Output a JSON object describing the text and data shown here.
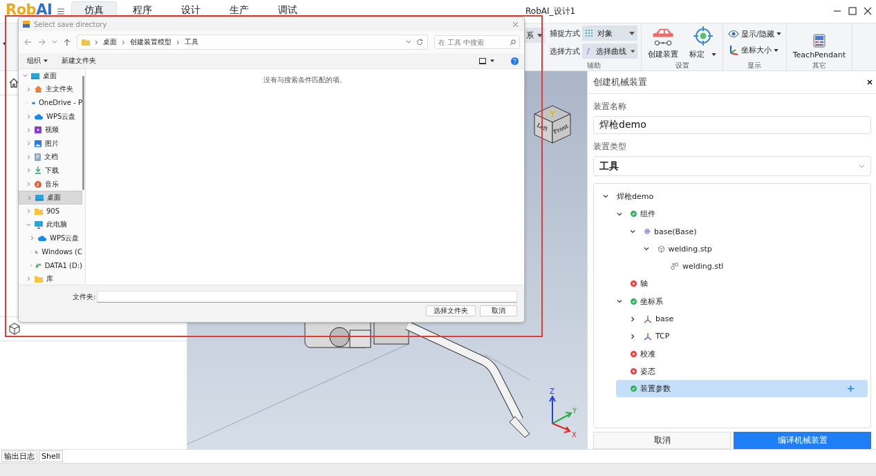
{
  "app": {
    "logo": [
      {
        "text": "Rob",
        "color": "#f0a81c"
      },
      {
        "text": "AI",
        "color": "#2f6fd6"
      }
    ],
    "title": "RobAI_设计1"
  },
  "menu_tabs": [
    {
      "label": "仿真",
      "selected": true
    },
    {
      "label": "程序",
      "selected": false
    },
    {
      "label": "设计",
      "selected": false
    },
    {
      "label": "生产",
      "selected": false
    },
    {
      "label": "调试",
      "selected": false
    }
  ],
  "ribbon": {
    "partial_dropdown": {
      "value": "系"
    },
    "groups": [
      {
        "label": "辅助",
        "items": [
          {
            "kind": "field",
            "label": "捕捉方式",
            "value": "对象"
          },
          {
            "kind": "field",
            "label": "选择方式",
            "value": "选择曲线"
          }
        ]
      },
      {
        "label": "设置",
        "items": [
          {
            "kind": "large",
            "label": "创建装置",
            "has_menu": false
          },
          {
            "kind": "large",
            "label": "标定",
            "has_menu": true
          }
        ]
      },
      {
        "label": "显示",
        "items": [
          {
            "kind": "small",
            "label": "显示/隐藏",
            "has_menu": true
          },
          {
            "kind": "small",
            "label": "坐标大小",
            "has_menu": true
          }
        ]
      },
      {
        "label": "其它",
        "items": [
          {
            "kind": "large",
            "label": "TeachPendant",
            "has_menu": false
          }
        ]
      }
    ]
  },
  "viewport": {
    "view_cube": [
      {
        "label": "Left"
      },
      {
        "label": "Front"
      }
    ],
    "axes": [
      {
        "label": "Z",
        "color": "#1f3fe0"
      },
      {
        "label": "Y",
        "color": "#22b03a"
      },
      {
        "label": "X",
        "color": "#e02424"
      }
    ]
  },
  "right_panel": {
    "title": "创建机械装置",
    "name_label": "装置名称",
    "name_value": "焊枪demo",
    "type_label": "装置类型",
    "type_value": "工具",
    "tree": [
      {
        "label": "焊枪demo",
        "expanded": true,
        "selected": false,
        "children": [
          {
            "label": "组件",
            "kind": "ok",
            "expanded": true,
            "selected": false,
            "children": [
              {
                "label": "base(Base)",
                "kind": "gear",
                "expanded": true,
                "selected": false,
                "children": [
                  {
                    "label": "welding.stp",
                    "kind": "cube",
                    "expanded": true,
                    "selected": false,
                    "children": [
                      {
                        "label": "welding.stl",
                        "kind": "mesh",
                        "selected": false
                      }
                    ]
                  }
                ]
              }
            ]
          },
          {
            "label": "轴",
            "kind": "error",
            "selected": false
          },
          {
            "label": "坐标系",
            "kind": "ok",
            "expanded": true,
            "selected": false,
            "children": [
              {
                "label": "base",
                "kind": "frame",
                "expanded": false,
                "selected": false
              },
              {
                "label": "TCP",
                "kind": "frame",
                "expanded": false,
                "selected": false
              }
            ]
          },
          {
            "label": "校准",
            "kind": "error",
            "selected": false
          },
          {
            "label": "姿态",
            "kind": "error",
            "selected": false
          },
          {
            "label": "装置参数",
            "kind": "ok",
            "selected": true
          }
        ]
      }
    ],
    "buttons": [
      {
        "label": "取消",
        "kind": "secondary"
      },
      {
        "label": "编译机械装置",
        "kind": "primary"
      }
    ]
  },
  "bottom_tabs": [
    {
      "label": "输出日志",
      "selected": false
    },
    {
      "label": "Shell",
      "selected": false
    }
  ],
  "dialog": {
    "title": "Select save directory",
    "breadcrumb": [
      "桌面",
      "创建装置模型",
      "工具"
    ],
    "search_placeholder": "在 工具 中搜索",
    "toolbar": [
      {
        "label": "组织",
        "has_menu": true
      },
      {
        "label": "新建文件夹",
        "has_menu": false
      }
    ],
    "nav_tree": [
      {
        "label": "桌面",
        "kind": "desktop",
        "expanded": true,
        "selected": false,
        "children": [
          {
            "label": "主文件夹",
            "kind": "home",
            "expanded": false,
            "selected": false
          },
          {
            "label": "OneDrive - P",
            "kind": "cloud",
            "expanded": false,
            "selected": false
          },
          {
            "label": "WPS云盘",
            "kind": "cloud",
            "expanded": false,
            "selected": false
          },
          {
            "label": "视频",
            "kind": "video",
            "expanded": false,
            "selected": false
          },
          {
            "label": "图片",
            "kind": "picture",
            "expanded": false,
            "selected": false
          },
          {
            "label": "文档",
            "kind": "document",
            "expanded": false,
            "selected": false
          },
          {
            "label": "下载",
            "kind": "download",
            "expanded": false,
            "selected": false
          },
          {
            "label": "音乐",
            "kind": "music",
            "expanded": false,
            "selected": false
          },
          {
            "label": "桌面",
            "kind": "desktop",
            "expanded": false,
            "selected": true
          },
          {
            "label": "90S",
            "kind": "folder",
            "expanded": false,
            "selected": false
          },
          {
            "label": "此电脑",
            "kind": "pc",
            "expanded": true,
            "selected": false,
            "children": [
              {
                "label": "WPS云盘",
                "kind": "cloud",
                "expanded": false,
                "selected": false
              },
              {
                "label": "Windows (C",
                "kind": "drive",
                "expanded": false,
                "selected": false
              },
              {
                "label": "DATA1 (D:)",
                "kind": "netdrive",
                "expanded": false,
                "selected": false
              }
            ]
          },
          {
            "label": "库",
            "kind": "folder",
            "expanded": false,
            "selected": false
          }
        ]
      }
    ],
    "empty_message": "没有与搜索条件匹配的项。",
    "folder_label": "文件夹:",
    "buttons": [
      {
        "label": "选择文件夹"
      },
      {
        "label": "取消"
      }
    ]
  }
}
